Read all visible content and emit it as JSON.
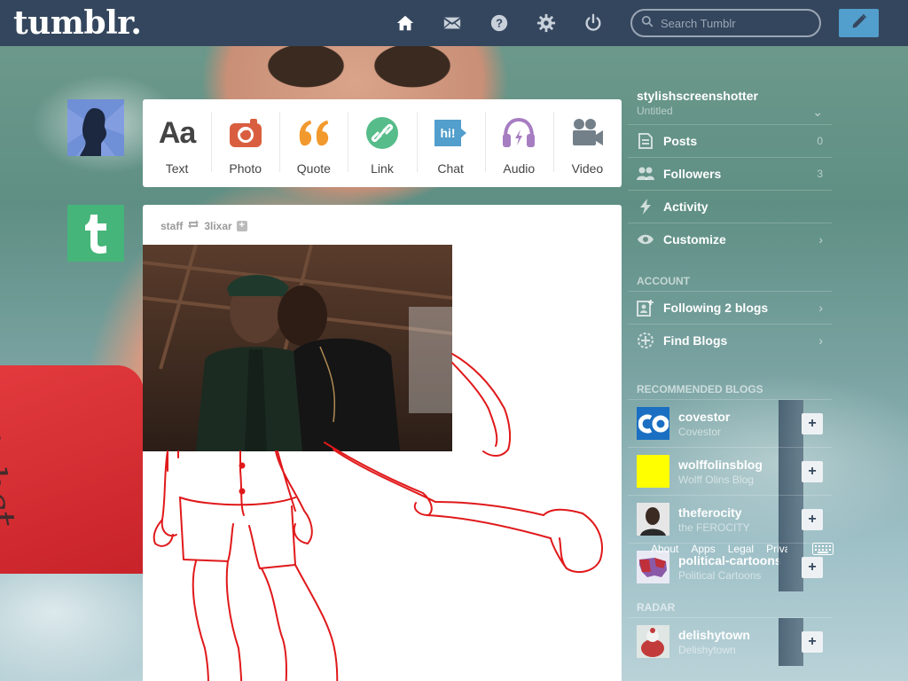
{
  "header": {
    "logo": "tumblr.",
    "search_placeholder": "Search Tumblr",
    "nav": [
      "home-icon",
      "inbox-icon",
      "help-icon",
      "settings-icon",
      "power-icon"
    ],
    "compose": "pencil-icon",
    "bg_color": "#34465d",
    "accent": "#529ecc"
  },
  "post_types": [
    {
      "label": "Text",
      "icon": "text-icon",
      "color": "#444444"
    },
    {
      "label": "Photo",
      "icon": "camera-icon",
      "color": "#d95e40"
    },
    {
      "label": "Quote",
      "icon": "quote-icon",
      "color": "#f2992e"
    },
    {
      "label": "Link",
      "icon": "link-icon",
      "color": "#56bc8a"
    },
    {
      "label": "Chat",
      "icon": "chat-icon",
      "color": "#529ecc"
    },
    {
      "label": "Audio",
      "icon": "headphones-icon",
      "color": "#a77dc2"
    },
    {
      "label": "Video",
      "icon": "video-camera-icon",
      "color": "#748089"
    }
  ],
  "post": {
    "author": "staff",
    "reblogged_from": "3lixar"
  },
  "background_board_text": "slobst",
  "sidebar": {
    "blog_name": "stylishscreenshotter",
    "blog_subtitle": "Untitled",
    "items": [
      {
        "label": "Posts",
        "count": "0",
        "icon": "posts-icon"
      },
      {
        "label": "Followers",
        "count": "3",
        "icon": "followers-icon"
      },
      {
        "label": "Activity",
        "count": "",
        "icon": "activity-icon"
      },
      {
        "label": "Customize",
        "count": "",
        "icon": "eye-icon"
      }
    ],
    "account_heading": "ACCOUNT",
    "account_items": [
      {
        "label": "Following 2 blogs",
        "icon": "following-icon"
      },
      {
        "label": "Find Blogs",
        "icon": "find-blogs-icon"
      }
    ],
    "recommended_heading": "RECOMMENDED BLOGS",
    "recommended": [
      {
        "name": "covestor",
        "title": "Covestor",
        "avatar_color": "#1a6fc2"
      },
      {
        "name": "wolffolinsblog",
        "title": "Wolff Olins Blog",
        "avatar_color": "#ffff00"
      },
      {
        "name": "theferocity",
        "title": "the FEROCITY",
        "avatar_color": "#cfcfcf"
      },
      {
        "name": "political-cartoons",
        "title": "Political Cartoons",
        "avatar_color": "#8a5aa8"
      }
    ],
    "radar_heading": "RADAR",
    "radar": [
      {
        "name": "delishytown",
        "title": "Delishytown",
        "avatar_color": "#c23b3b"
      }
    ],
    "footer_links": [
      "About",
      "Apps",
      "Legal",
      "Privacy"
    ]
  }
}
